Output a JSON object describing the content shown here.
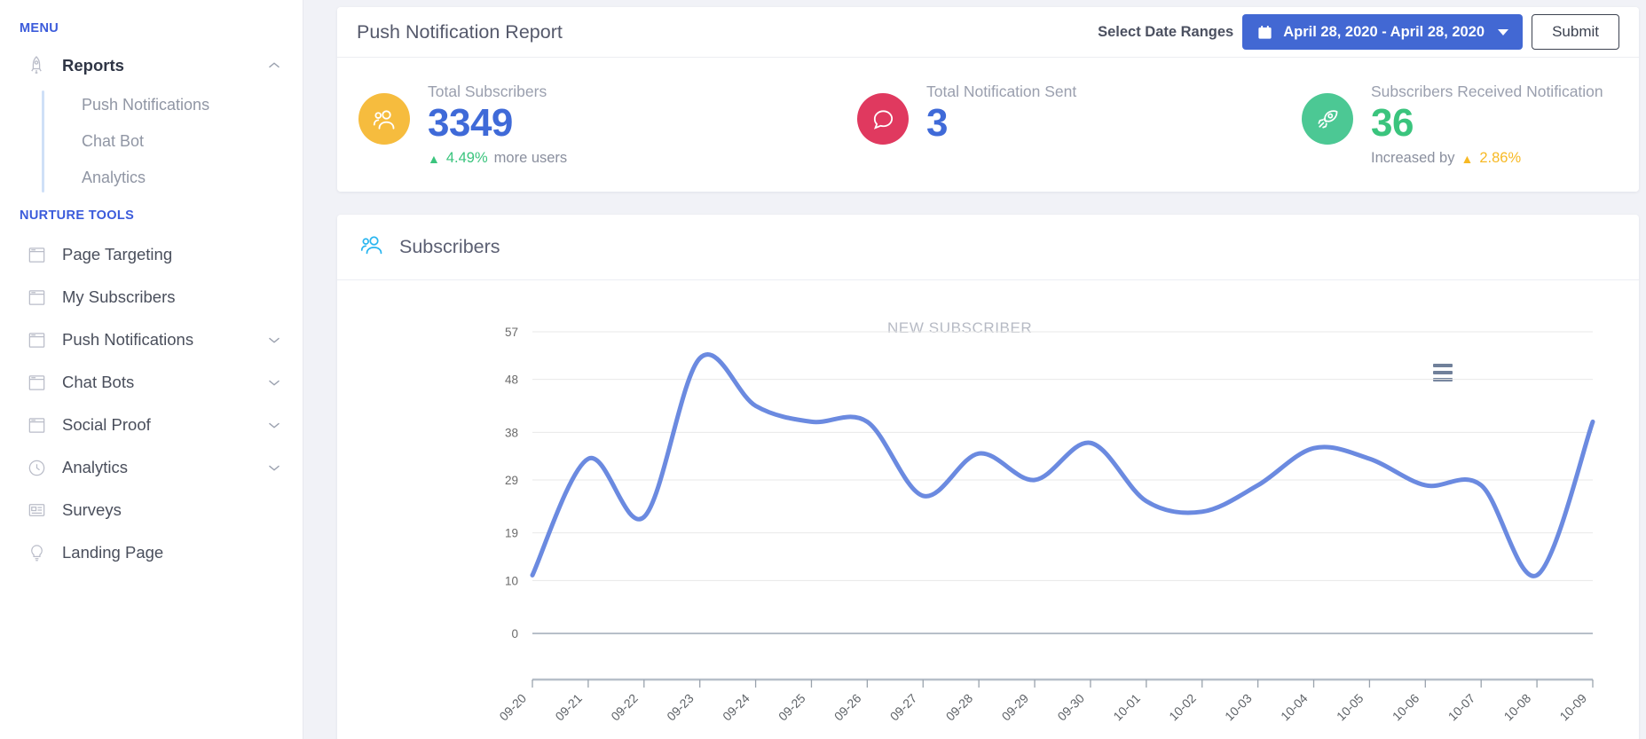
{
  "sidebar": {
    "menu_label": "MENU",
    "section_label": "NURTURE TOOLS",
    "reports": {
      "label": "Reports",
      "icon": "rocket-icon",
      "chevron": "chevron-up-icon"
    },
    "report_subitems": [
      {
        "label": "Push Notifications"
      },
      {
        "label": "Chat Bot"
      },
      {
        "label": "Analytics"
      }
    ],
    "tools": [
      {
        "label": "Page Targeting",
        "icon": "window-icon",
        "chevron": false
      },
      {
        "label": "My Subscribers",
        "icon": "window-icon",
        "chevron": false
      },
      {
        "label": "Push Notifications",
        "icon": "window-icon",
        "chevron": true
      },
      {
        "label": "Chat Bots",
        "icon": "window-icon",
        "chevron": true
      },
      {
        "label": "Social Proof",
        "icon": "window-icon",
        "chevron": true
      },
      {
        "label": "Analytics",
        "icon": "clock-icon",
        "chevron": true
      },
      {
        "label": "Surveys",
        "icon": "survey-icon",
        "chevron": false
      },
      {
        "label": "Landing Page",
        "icon": "bulb-icon",
        "chevron": false
      }
    ]
  },
  "header": {
    "title": "Push Notification Report",
    "date_label": "Select Date Ranges",
    "date_value": "April 28, 2020 - April 28, 2020",
    "calendar_icon": "calendar-icon",
    "caret_icon": "chevron-down-icon",
    "submit_label": "Submit"
  },
  "stats": [
    {
      "caption": "Total Subscribers",
      "value": "3349",
      "value_color": "#3f6ad8",
      "circle_color": "#f6bc3e",
      "icon": "users-icon",
      "sub_prefix": "",
      "arrow": "▲",
      "percent": "4.49%",
      "percent_color": "#3ac47d",
      "sub_suffix": "more users"
    },
    {
      "caption": "Total Notification Sent",
      "value": "3",
      "value_color": "#3f6ad8",
      "circle_color": "#e0395f",
      "icon": "chat-bubble-icon",
      "sub_prefix": "",
      "arrow": "",
      "percent": "",
      "percent_color": "",
      "sub_suffix": ""
    },
    {
      "caption": "Subscribers Received Notification",
      "value": "36",
      "value_color": "#3ac47d",
      "circle_color": "#4cc894",
      "icon": "rocket-icon",
      "sub_prefix": "Increased by",
      "arrow": "▲",
      "percent": "2.86%",
      "percent_color": "#f7b924",
      "sub_suffix": ""
    }
  ],
  "chart_panel": {
    "title": "Subscribers",
    "icon": "users-icon",
    "menu_icon": "hamburger-menu-icon"
  },
  "chart_data": {
    "type": "line",
    "title": "NEW SUBSCRIBER",
    "xlabel": "",
    "ylabel": "",
    "grid": true,
    "legend": false,
    "line_color": "#6b8ae0",
    "ylim": [
      0,
      57
    ],
    "yticks": [
      0,
      10,
      19,
      29,
      38,
      48,
      57
    ],
    "categories": [
      "09-20",
      "09-21",
      "09-22",
      "09-23",
      "09-24",
      "09-25",
      "09-26",
      "09-27",
      "09-28",
      "09-29",
      "09-30",
      "10-01",
      "10-02",
      "10-03",
      "10-04",
      "10-05",
      "10-06",
      "10-07",
      "10-08",
      "10-09"
    ],
    "series": [
      {
        "name": "NEW SUBSCRIBER",
        "values": [
          11,
          33,
          22,
          52,
          43,
          40,
          40,
          26,
          34,
          29,
          36,
          25,
          23,
          28,
          35,
          33,
          28,
          28,
          11,
          40
        ]
      }
    ]
  }
}
